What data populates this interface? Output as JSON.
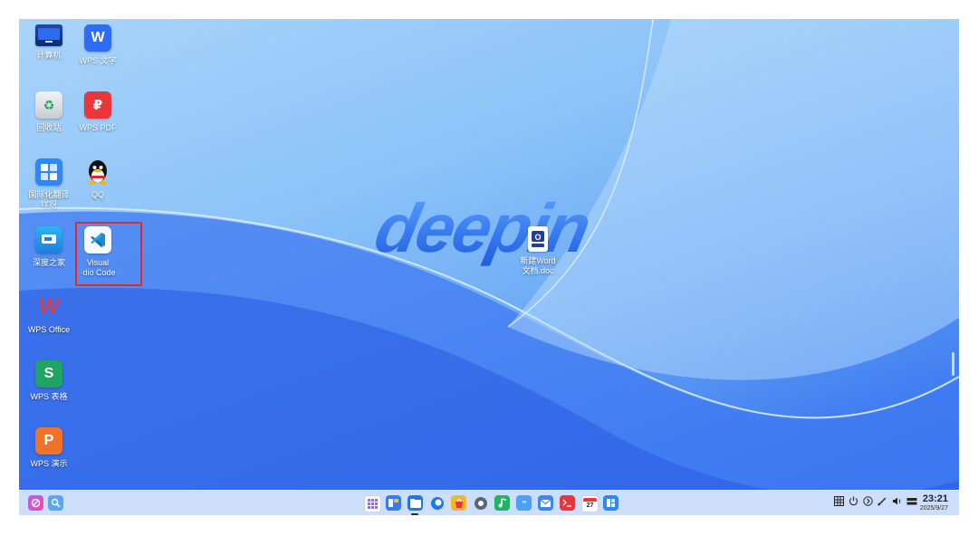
{
  "desktop": {
    "wallpaper_text": "deepin",
    "icons": [
      {
        "label": "计算机",
        "icon": "computer-icon"
      },
      {
        "label": "WPS 文字",
        "icon": "wps-writer-icon"
      },
      {
        "label": "回收站",
        "icon": "trash-icon"
      },
      {
        "label": "WPS PDF",
        "icon": "wps-pdf-icon"
      },
      {
        "label": "国际化翻译\n咩呀",
        "icon": "translation-icon"
      },
      {
        "label": "QQ",
        "icon": "qq-penguin-icon"
      },
      {
        "label": "深度之家",
        "icon": "deepin-home-icon"
      },
      {
        "label": "Visual\n·dio Code",
        "icon": "vscode-icon"
      },
      {
        "label": "WPS Office",
        "icon": "wps-office-icon"
      },
      {
        "label": "WPS 表格",
        "icon": "wps-spreadsheet-icon"
      },
      {
        "label": "WPS 演示",
        "icon": "wps-presentation-icon"
      },
      {
        "label": "新建Word\n文档.doc",
        "icon": "word-doc-icon"
      }
    ],
    "colors": {
      "selection": "#e02a2a",
      "wps_blue": "#2f6cf6",
      "wps_red": "#e8363a",
      "wps_green": "#1fa463",
      "wps_orange": "#f0732b"
    }
  },
  "taskbar": {
    "left": [
      "launcher-icon",
      "search-icon"
    ],
    "apps": [
      "multitask-view-icon",
      "workspace-icon",
      "file-manager-icon",
      "browser-icon",
      "app-store-icon",
      "settings-icon",
      "music-icon",
      "text-editor-icon",
      "mail-icon",
      "terminal-icon",
      "calendar-icon",
      "device-manager-icon"
    ],
    "calendar_day": "27",
    "tray": [
      "grid-icon",
      "power-icon",
      "arrow-right-circle-icon",
      "pen-icon",
      "volume-icon",
      "keyboard-icon"
    ],
    "clock": {
      "time": "23:21",
      "date": "2025/9/27"
    }
  }
}
